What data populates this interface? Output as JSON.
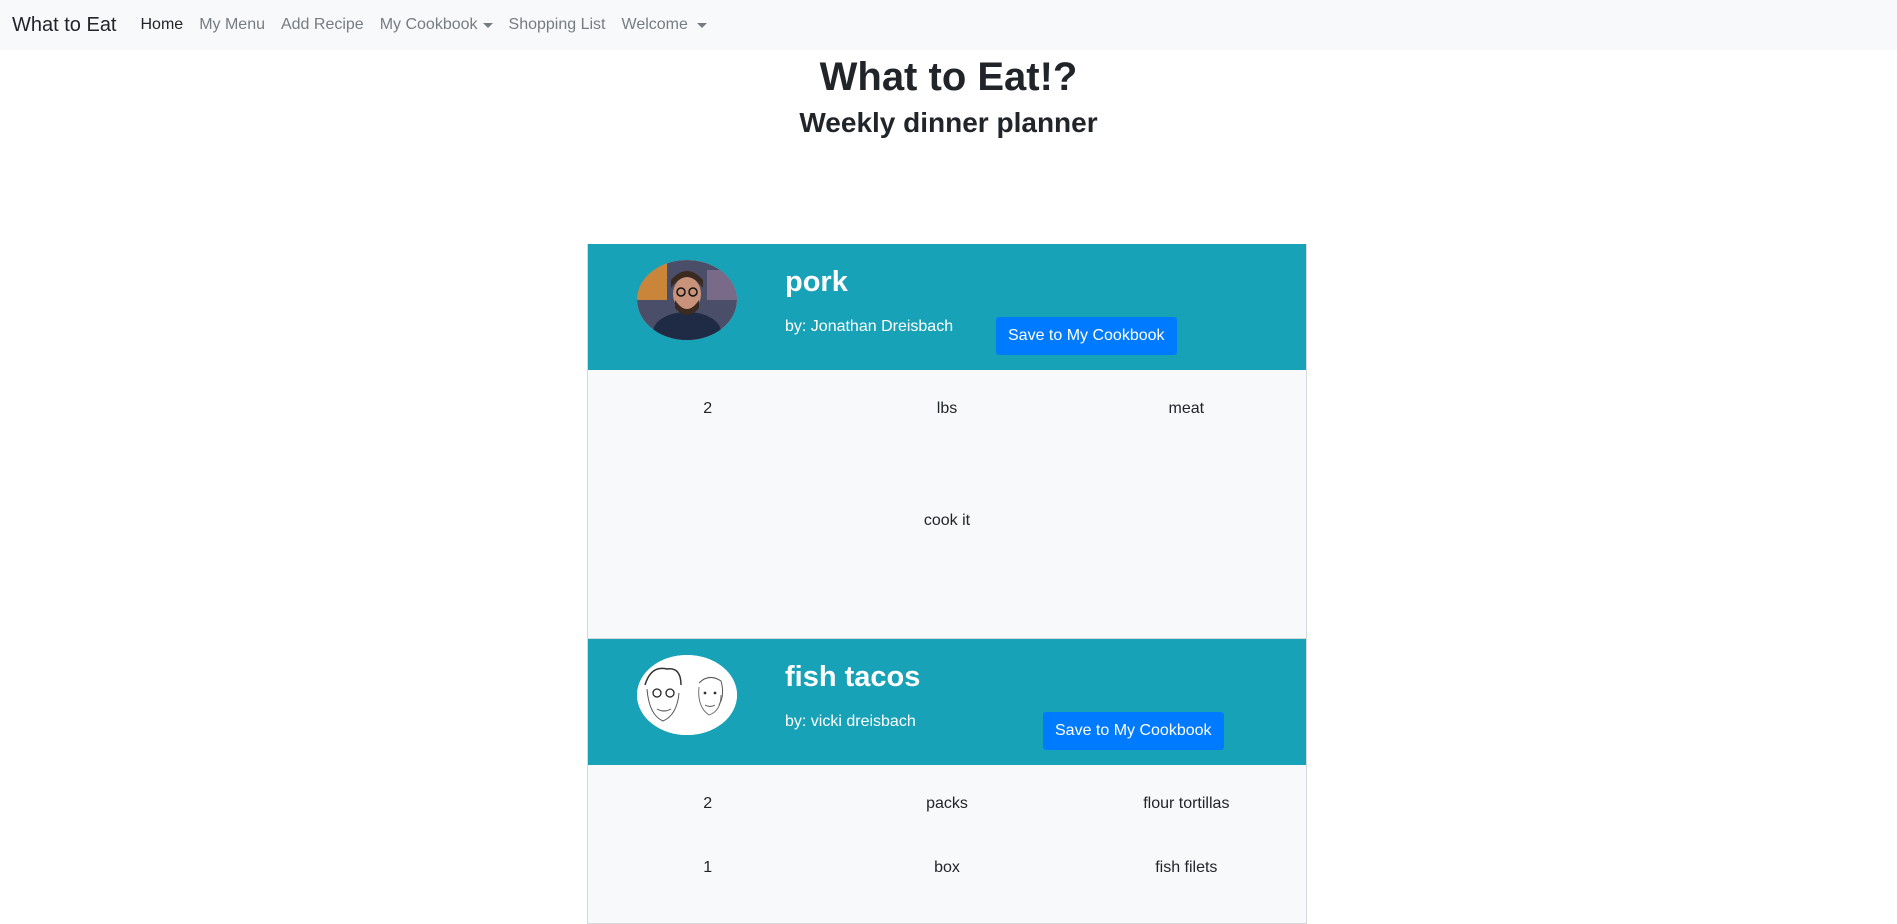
{
  "nav": {
    "brand": "What to Eat",
    "links": [
      "Home",
      "My Menu",
      "Add Recipe",
      "My Cookbook",
      "Shopping List",
      "Welcome"
    ]
  },
  "hero": {
    "title": "What to Eat!?",
    "subtitle": "Weekly dinner planner"
  },
  "recipes": [
    {
      "title": "pork",
      "author": "by: Jonathan Dreisbach",
      "save_label": "Save to My Cookbook",
      "ingredients": [
        [
          "2",
          "lbs",
          "meat"
        ]
      ],
      "directions": "cook it"
    },
    {
      "title": "fish tacos",
      "author": "by: vicki dreisbach",
      "save_label": "Save to My Cookbook",
      "ingredients": [
        [
          "2",
          "packs",
          "flour tortillas"
        ],
        [
          "1",
          "box",
          "fish filets"
        ]
      ]
    }
  ],
  "colors": {
    "navbar_bg": "#f8f9fa",
    "card_header": "#17a2b8",
    "primary_button": "#007bff"
  }
}
